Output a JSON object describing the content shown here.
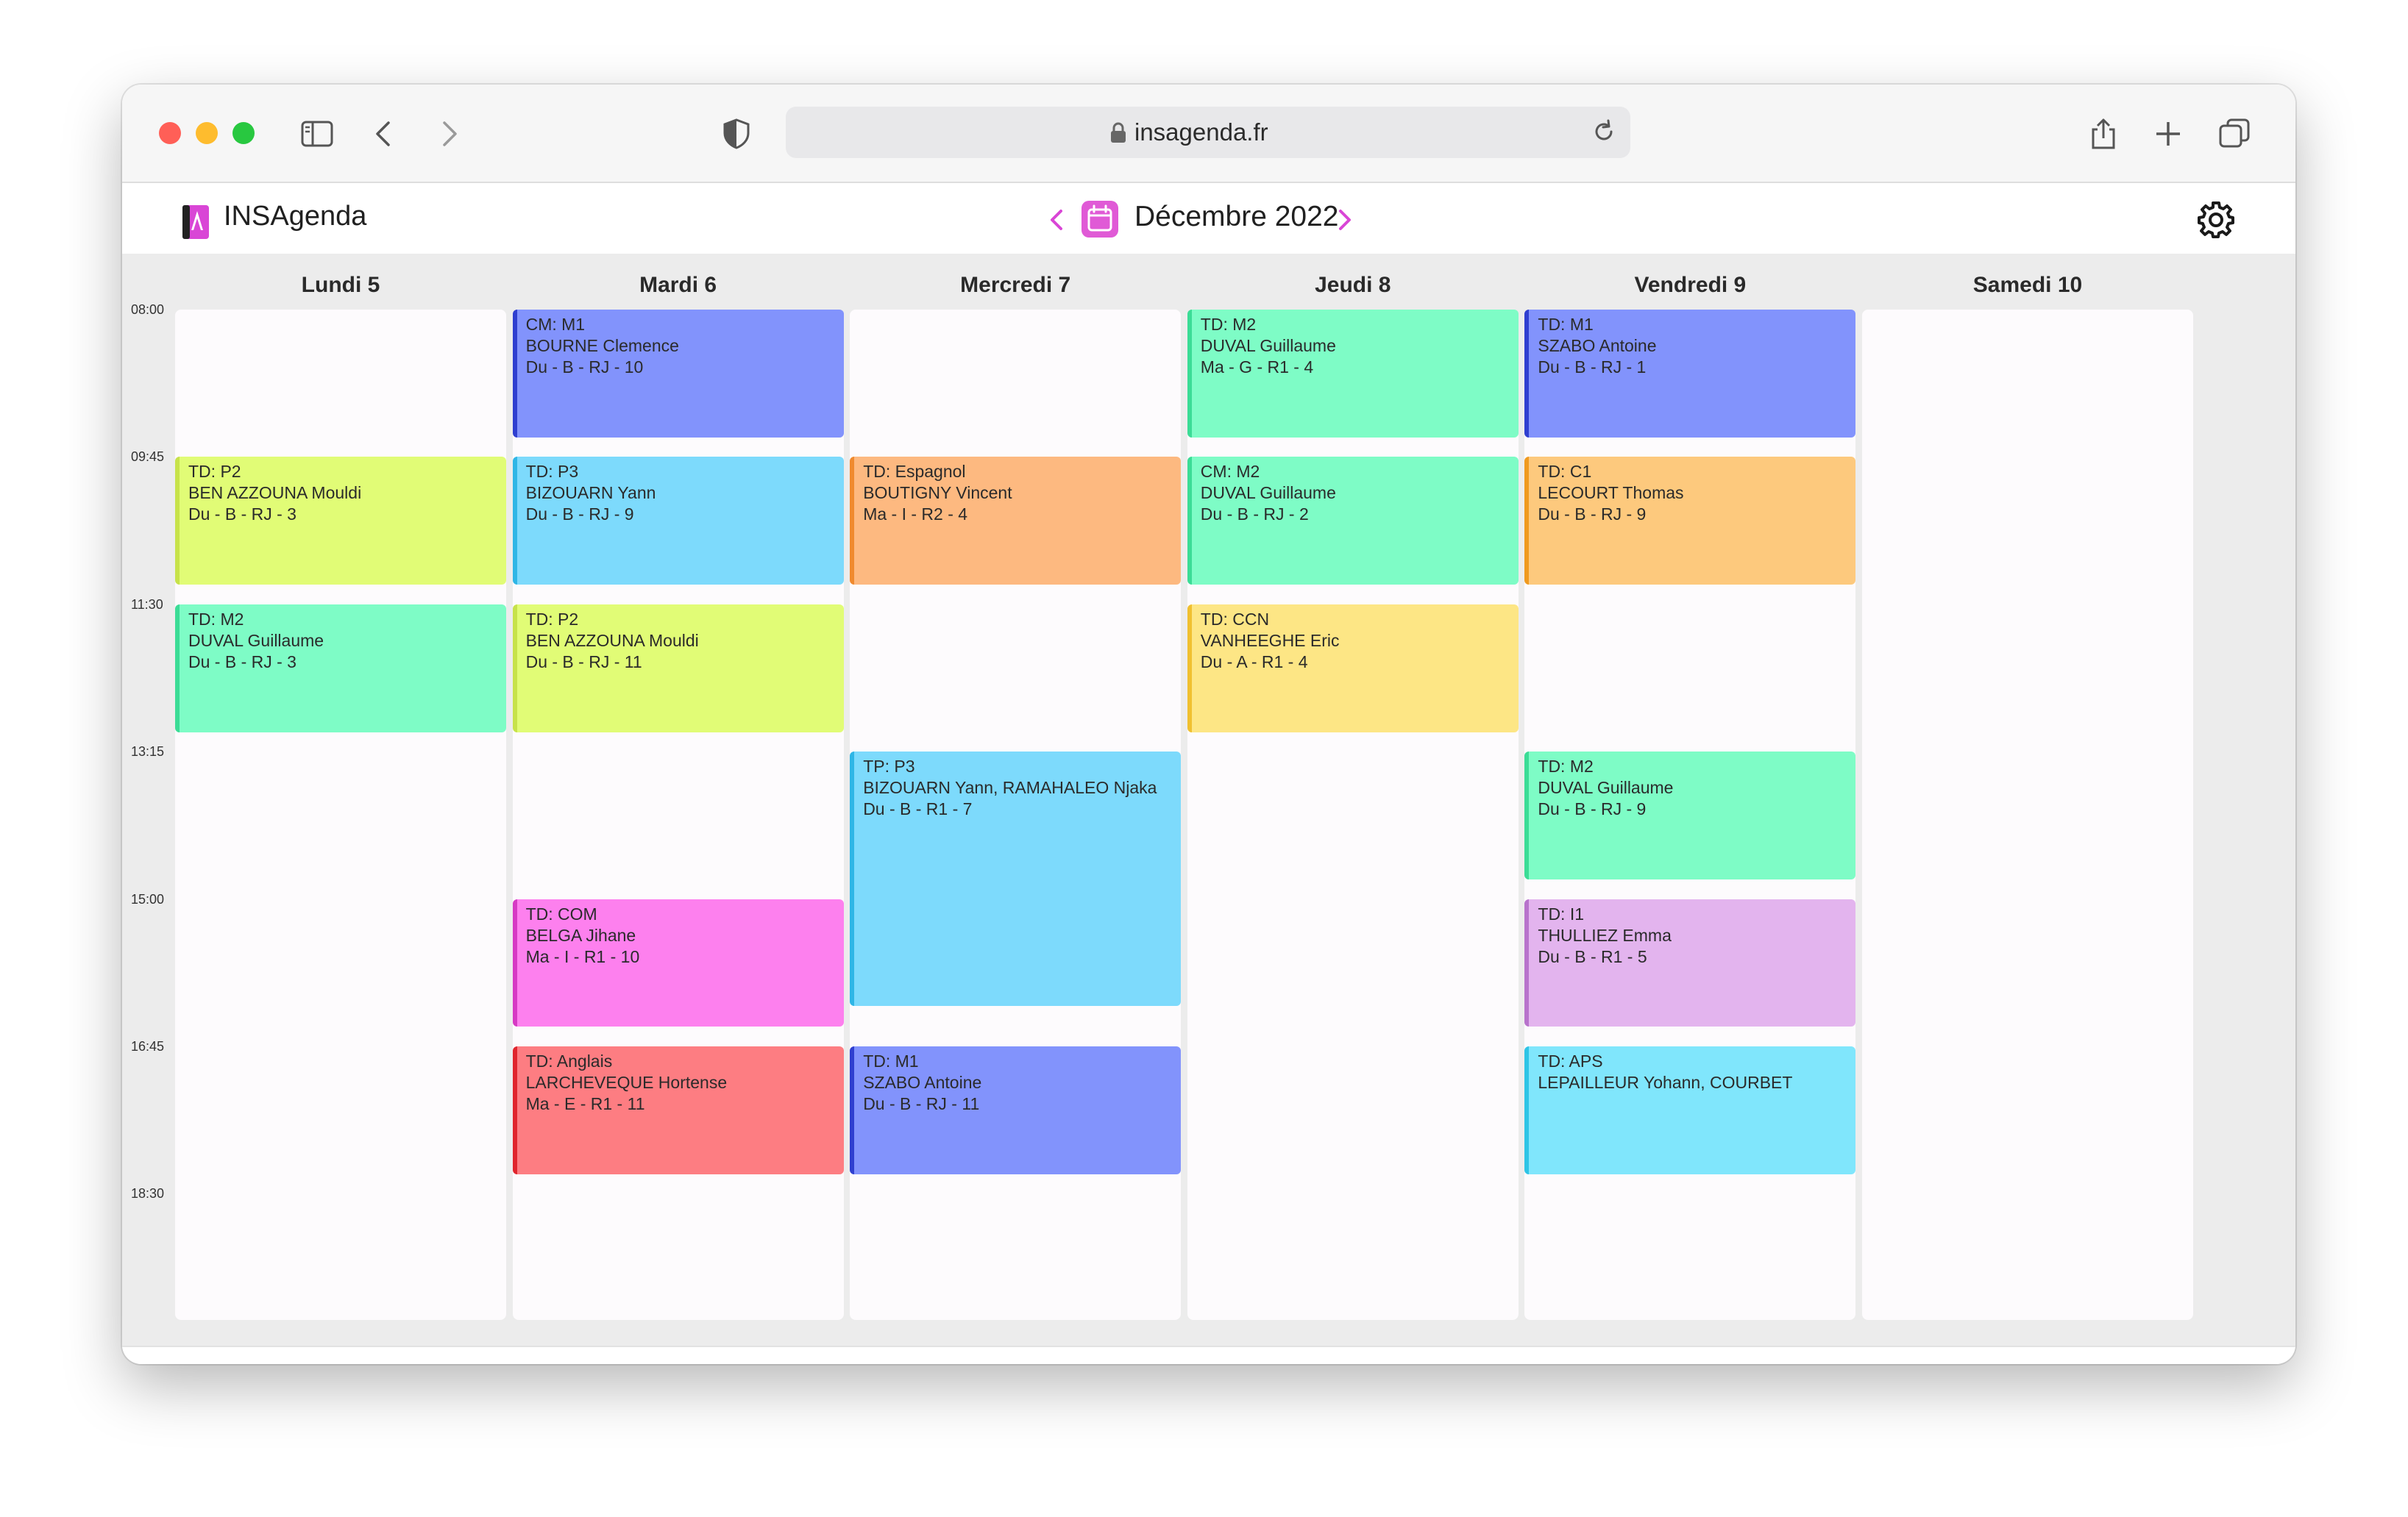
{
  "browser": {
    "url": "insagenda.fr",
    "icons": [
      "sidebar-icon",
      "back-icon",
      "forward-icon",
      "shield-icon",
      "lock-icon",
      "reload-icon",
      "share-icon",
      "new-tab-icon",
      "tabs-overview-icon"
    ],
    "traffic_lights": [
      "#ff5f57",
      "#febc2e",
      "#28c840"
    ]
  },
  "app": {
    "title": "INSAgenda",
    "month_label": "Décembre 2022",
    "accent_color": "#d946d6",
    "icons": [
      "app-logo-icon",
      "prev-month-icon",
      "calendar-icon",
      "next-month-icon",
      "settings-gear-icon"
    ]
  },
  "times": [
    "08:00",
    "09:45",
    "11:30",
    "13:15",
    "15:00",
    "16:45",
    "18:30"
  ],
  "days": [
    {
      "label": "Lundi 5",
      "events": [
        {
          "start": "09:45",
          "end": "11:15",
          "color": "#e1fc76",
          "border": "#c7e24a",
          "lines": [
            "TD: P2",
            "BEN AZZOUNA Mouldi",
            "Du - B - RJ - 3"
          ]
        },
        {
          "start": "11:30",
          "end": "13:00",
          "color": "#7efcc6",
          "border": "#3bdc96",
          "lines": [
            "TD: M2",
            "DUVAL Guillaume",
            "Du - B - RJ - 3"
          ]
        }
      ]
    },
    {
      "label": "Mardi 6",
      "events": [
        {
          "start": "08:00",
          "end": "09:30",
          "color": "#8293fc",
          "border": "#2f3fd0",
          "lines": [
            "CM: M1",
            "BOURNE Clemence",
            "Du - B - RJ - 10"
          ]
        },
        {
          "start": "09:45",
          "end": "11:15",
          "color": "#7ddafc",
          "border": "#2fb6e6",
          "lines": [
            "TD: P3",
            "BIZOUARN Yann",
            "Du - B - RJ - 9"
          ]
        },
        {
          "start": "11:30",
          "end": "13:00",
          "color": "#e1fc76",
          "border": "#c7e24a",
          "lines": [
            "TD: P2",
            "BEN AZZOUNA Mouldi",
            "Du - B - RJ - 11"
          ]
        },
        {
          "start": "15:00",
          "end": "16:30",
          "color": "#fd80ee",
          "border": "#d63ac4",
          "lines": [
            "TD: COM",
            "BELGA Jihane",
            "Ma - I - R1 - 10"
          ]
        },
        {
          "start": "16:45",
          "end": "18:15",
          "color": "#fd7d82",
          "border": "#e0252d",
          "lines": [
            "TD: Anglais",
            "LARCHEVEQUE Hortense",
            "Ma - E - R1 - 11"
          ]
        }
      ]
    },
    {
      "label": "Mercredi 7",
      "events": [
        {
          "start": "09:45",
          "end": "11:15",
          "color": "#fdb980",
          "border": "#f08a2e",
          "lines": [
            "TD: Espagnol",
            "BOUTIGNY Vincent",
            "Ma - I - R2 - 4"
          ]
        },
        {
          "start": "13:15",
          "end": "16:15",
          "color": "#7ddafc",
          "border": "#2fb6e6",
          "lines": [
            "TP: P3",
            "BIZOUARN Yann, RAMAHALEO Njaka",
            "Du - B - R1 - 7"
          ]
        },
        {
          "start": "16:45",
          "end": "18:15",
          "color": "#8293fc",
          "border": "#2f3fd0",
          "lines": [
            "TD: M1",
            "SZABO Antoine",
            "Du - B - RJ - 11"
          ]
        }
      ]
    },
    {
      "label": "Jeudi 8",
      "events": [
        {
          "start": "08:00",
          "end": "09:30",
          "color": "#7efcc6",
          "border": "#3bdc96",
          "lines": [
            "TD: M2",
            "DUVAL Guillaume",
            "Ma - G - R1 - 4"
          ]
        },
        {
          "start": "09:45",
          "end": "11:15",
          "color": "#7efcc6",
          "border": "#3bdc96",
          "lines": [
            "CM: M2",
            "DUVAL Guillaume",
            "Du - B - RJ - 2"
          ]
        },
        {
          "start": "11:30",
          "end": "13:00",
          "color": "#fde685",
          "border": "#f0c030",
          "lines": [
            "TD: CCN",
            "VANHEEGHE Eric",
            "Du - A - R1 - 4"
          ]
        }
      ]
    },
    {
      "label": "Vendredi 9",
      "events": [
        {
          "start": "08:00",
          "end": "09:30",
          "color": "#8293fc",
          "border": "#2f3fd0",
          "lines": [
            "TD: M1",
            "SZABO Antoine",
            "Du - B - RJ - 1"
          ]
        },
        {
          "start": "09:45",
          "end": "11:15",
          "color": "#fdc97d",
          "border": "#f09a20",
          "lines": [
            "TD: C1",
            "LECOURT Thomas",
            "Du - B - RJ - 9"
          ]
        },
        {
          "start": "13:15",
          "end": "14:45",
          "color": "#7efcc6",
          "border": "#3bdc96",
          "lines": [
            "TD: M2",
            "DUVAL Guillaume",
            "Du - B - RJ - 9"
          ]
        },
        {
          "start": "15:00",
          "end": "16:30",
          "color": "#e3b4ee",
          "border": "#b873cc",
          "lines": [
            "TD: I1",
            "THULLIEZ Emma",
            "Du - B - R1 - 5"
          ]
        },
        {
          "start": "16:45",
          "end": "18:15",
          "color": "#80e6fc",
          "border": "#2fc4e6",
          "lines": [
            "TD: APS",
            "LEPAILLEUR Yohann, COURBET"
          ]
        }
      ]
    },
    {
      "label": "Samedi 10",
      "events": []
    }
  ]
}
